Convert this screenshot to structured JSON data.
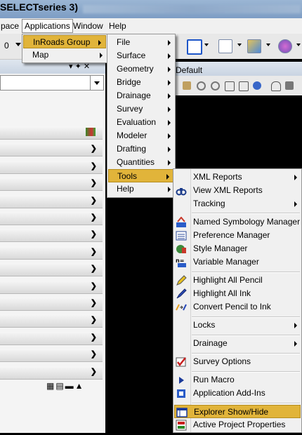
{
  "window": {
    "title_fragment": "SELECTseries 3)"
  },
  "menubar": {
    "items": [
      "pace",
      "Applications",
      "Window",
      "Help"
    ]
  },
  "toolbar": {
    "level_value": "0"
  },
  "view": {
    "title": "Default"
  },
  "applications_menu": {
    "items": [
      "InRoads Group",
      "Map"
    ]
  },
  "inroads_menu": {
    "items": [
      "File",
      "Surface",
      "Geometry",
      "Bridge",
      "Drainage",
      "Survey",
      "Evaluation",
      "Modeler",
      "Drafting",
      "Quantities",
      "Tools",
      "Help"
    ]
  },
  "tools_menu": {
    "items": [
      "XML Reports",
      "View XML Reports",
      "Tracking",
      "Named Symbology Manager",
      "Preference Manager",
      "Style Manager",
      "Variable Manager",
      "Highlight All Pencil",
      "Highlight All Ink",
      "Convert Pencil to Ink",
      "Locks",
      "Drainage",
      "Survey Options",
      "Run Macro",
      "Application Add-Ins",
      "Explorer Show/Hide",
      "Active Project Properties"
    ]
  },
  "icons": {
    "view_xml_reports": "binoculars-icon",
    "named_symbology_manager": "symbology-icon",
    "preference_manager": "preferences-icon",
    "style_manager": "style-icon",
    "variable_manager": "variable-icon",
    "highlight_all_pencil": "pencil-icon",
    "highlight_all_ink": "ink-pen-icon",
    "convert_pencil_to_ink": "convert-icon",
    "survey_options": "survey-check-icon",
    "run_macro": "play-icon",
    "application_add_ins": "addins-icon",
    "explorer_show_hide": "explorer-window-icon",
    "active_project_properties": "project-properties-icon"
  },
  "colors": {
    "highlight": "#e1b43a",
    "menu_bg": "#f0f0f0",
    "title_bar": "#8aa7cb"
  }
}
